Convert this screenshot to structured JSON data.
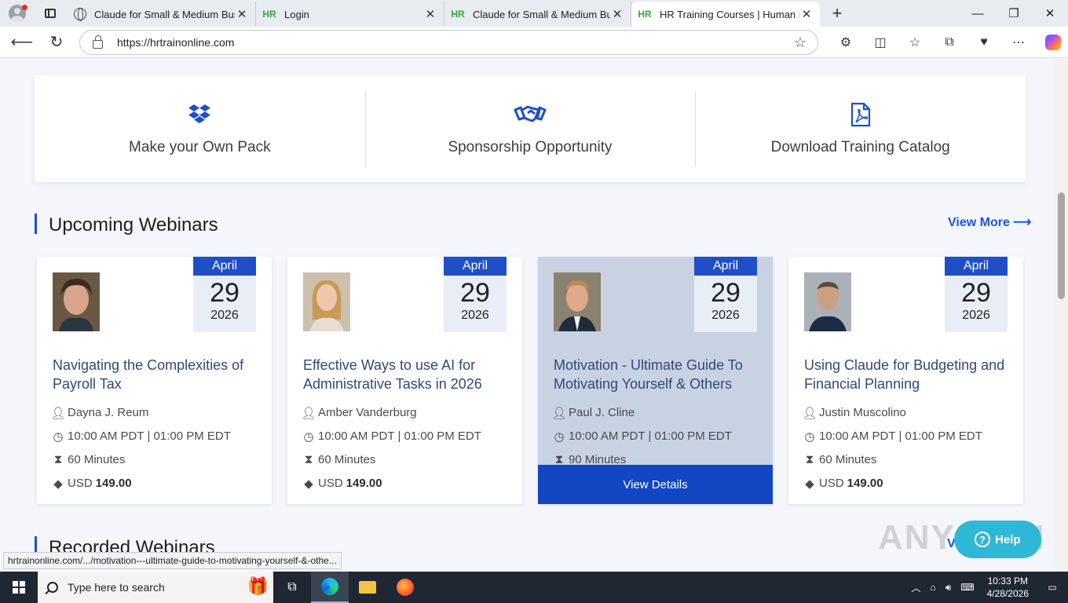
{
  "browser": {
    "tabs": [
      {
        "title": "Claude for Small & Medium Busin",
        "icon": "globe-icon",
        "active": false
      },
      {
        "title": "Login",
        "icon": "hr-icon",
        "active": false
      },
      {
        "title": "Claude for Small & Medium Busin",
        "icon": "hr-icon",
        "active": false
      },
      {
        "title": "HR Training Courses | Human Reso",
        "icon": "hr-icon",
        "active": true
      }
    ],
    "hr_badge": "HR",
    "url": "https://hrtrainonline.com",
    "status_url": "hrtrainonline.com/.../motivation---ultimate-guide-to-motivating-yourself-&-othe..."
  },
  "features": [
    {
      "label": "Make your Own Pack",
      "icon": "dropbox-icon"
    },
    {
      "label": "Sponsorship Opportunity",
      "icon": "handshake-icon"
    },
    {
      "label": "Download Training Catalog",
      "icon": "pdf-icon"
    }
  ],
  "upcoming": {
    "title": "Upcoming Webinars",
    "view_more": "View More ⟶",
    "cards": [
      {
        "month": "April",
        "day": "29",
        "year": "2026",
        "title": "Navigating the Complexities of Payroll Tax",
        "speaker": "Dayna J. Reum",
        "time": "10:00 AM PDT | 01:00 PM EDT",
        "duration": "60 Minutes",
        "currency": "USD",
        "price": "149.00"
      },
      {
        "month": "April",
        "day": "29",
        "year": "2026",
        "title": "Effective Ways to use AI for Administrative Tasks in 2026",
        "speaker": "Amber Vanderburg",
        "time": "10:00 AM PDT | 01:00 PM EDT",
        "duration": "60 Minutes",
        "currency": "USD",
        "price": "149.00"
      },
      {
        "month": "April",
        "day": "29",
        "year": "2026",
        "title": "Motivation - Ultimate Guide To Motivating Yourself & Others",
        "speaker": "Paul J. Cline",
        "time": "10:00 AM PDT | 01:00 PM EDT",
        "duration": "90 Minutes",
        "button": "View Details"
      },
      {
        "month": "April",
        "day": "29",
        "year": "2026",
        "title": "Using Claude for Budgeting and Financial Planning",
        "speaker": "Justin Muscolino",
        "time": "10:00 AM PDT | 01:00 PM EDT",
        "duration": "60 Minutes",
        "currency": "USD",
        "price": "149.00"
      }
    ]
  },
  "recorded": {
    "title": "Recorded Webinars",
    "view_partial": "V"
  },
  "help": {
    "label": "Help",
    "q": "?"
  },
  "watermark": "ANY RUN",
  "taskbar": {
    "search_placeholder": "Type here to search",
    "time": "10:33 PM",
    "date": "4/28/2026"
  }
}
